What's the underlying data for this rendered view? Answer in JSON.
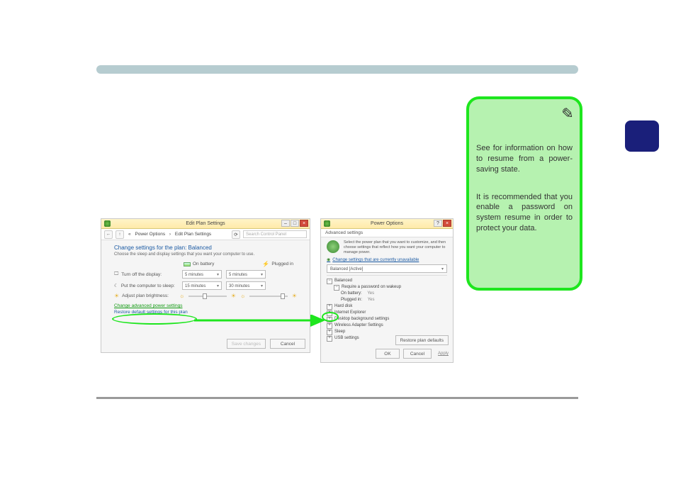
{
  "note": {
    "see": "See",
    "see_after": "for information on how to resume from a power-saving state.",
    "recommended": "It is recommended that you enable a password on system resume in order to protect your data."
  },
  "winLeft": {
    "title": "Edit Plan Settings",
    "min": "–",
    "max": "□",
    "close": "×",
    "back": "←",
    "fwd": "↑",
    "crumb1": "«",
    "crumb2": "Power Options",
    "crumb3": "›",
    "crumb4": "Edit Plan Settings",
    "refresh": "⟳",
    "search_placeholder": "Search Control Panel",
    "heading": "Change settings for the plan: Balanced",
    "sub": "Choose the sleep and display settings that you want your computer to use.",
    "col_batt": "On battery",
    "col_plug": "Plugged in",
    "row1": "Turn off the display:",
    "row2": "Put the computer to sleep:",
    "row3": "Adjust plan brightness:",
    "v_5a": "5 minutes",
    "v_5b": "5 minutes",
    "v_15": "15 minutes",
    "v_30": "30 minutes",
    "link_adv": "Change advanced power settings",
    "link_restore": "Restore default settings for this plan",
    "btn_save": "Save changes",
    "btn_cancel": "Cancel"
  },
  "winRight": {
    "title": "Power Options",
    "help": "?",
    "close": "×",
    "tab": "Advanced settings",
    "intro": "Select the power plan that you want to customize, and then choose settings that reflect how you want your computer to manage power.",
    "link_unavail": "Change settings that are currently unavailable",
    "combo": "Balanced [Active]",
    "t_balanced": "Balanced",
    "t_req": "Require a password on wakeup",
    "t_onbatt": "On battery:",
    "t_onbatt_v": "Yes",
    "t_plugged": "Plugged in:",
    "t_plugged_v": "Yes",
    "t_hdd": "Hard disk",
    "t_ie": "Internet Explorer",
    "t_desk": "Desktop background settings",
    "t_wifi": "Wireless Adapter Settings",
    "t_sleep": "Sleep",
    "t_usb": "USB settings",
    "btn_restore": "Restore plan defaults",
    "btn_ok": "OK",
    "btn_cancel": "Cancel",
    "btn_apply": "Apply"
  }
}
